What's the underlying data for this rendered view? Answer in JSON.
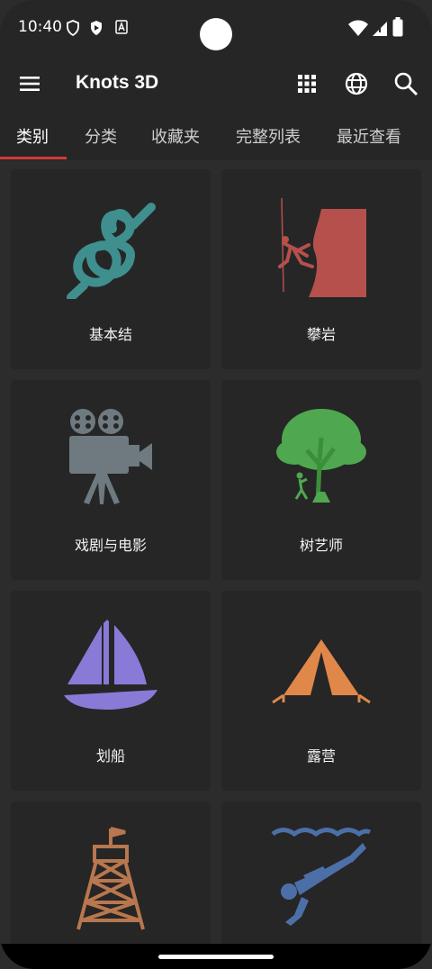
{
  "status": {
    "time": "10:40",
    "icons": [
      "shield-icon",
      "play-protect-icon",
      "a-icon",
      "wifi-icon",
      "signal-icon",
      "battery-icon"
    ]
  },
  "appbar": {
    "title": "Knots 3D",
    "icons": [
      "menu-icon",
      "grid-icon",
      "globe-icon",
      "search-icon"
    ]
  },
  "tabs": [
    "类别",
    "分类",
    "收藏夹",
    "完整列表",
    "最近查看"
  ],
  "categories": [
    {
      "label": "基本结",
      "icon": "knot-icon",
      "color": "#3f8f8f"
    },
    {
      "label": "攀岩",
      "icon": "climbing-icon",
      "color": "#b5504c"
    },
    {
      "label": "戏剧与电影",
      "icon": "film-camera-icon",
      "color": "#6e7a80"
    },
    {
      "label": "树艺师",
      "icon": "tree-icon",
      "color": "#4fa84f"
    },
    {
      "label": "划船",
      "icon": "sailboat-icon",
      "color": "#8a7ad8"
    },
    {
      "label": "露营",
      "icon": "tent-icon",
      "color": "#e0874a"
    },
    {
      "label": "",
      "icon": "tower-icon",
      "color": "#b8774e"
    },
    {
      "label": "",
      "icon": "diver-icon",
      "color": "#4d6fa8"
    }
  ],
  "colors": {
    "accent": "#d23b3b",
    "card": "#262626",
    "background": "#2c2c2c"
  }
}
